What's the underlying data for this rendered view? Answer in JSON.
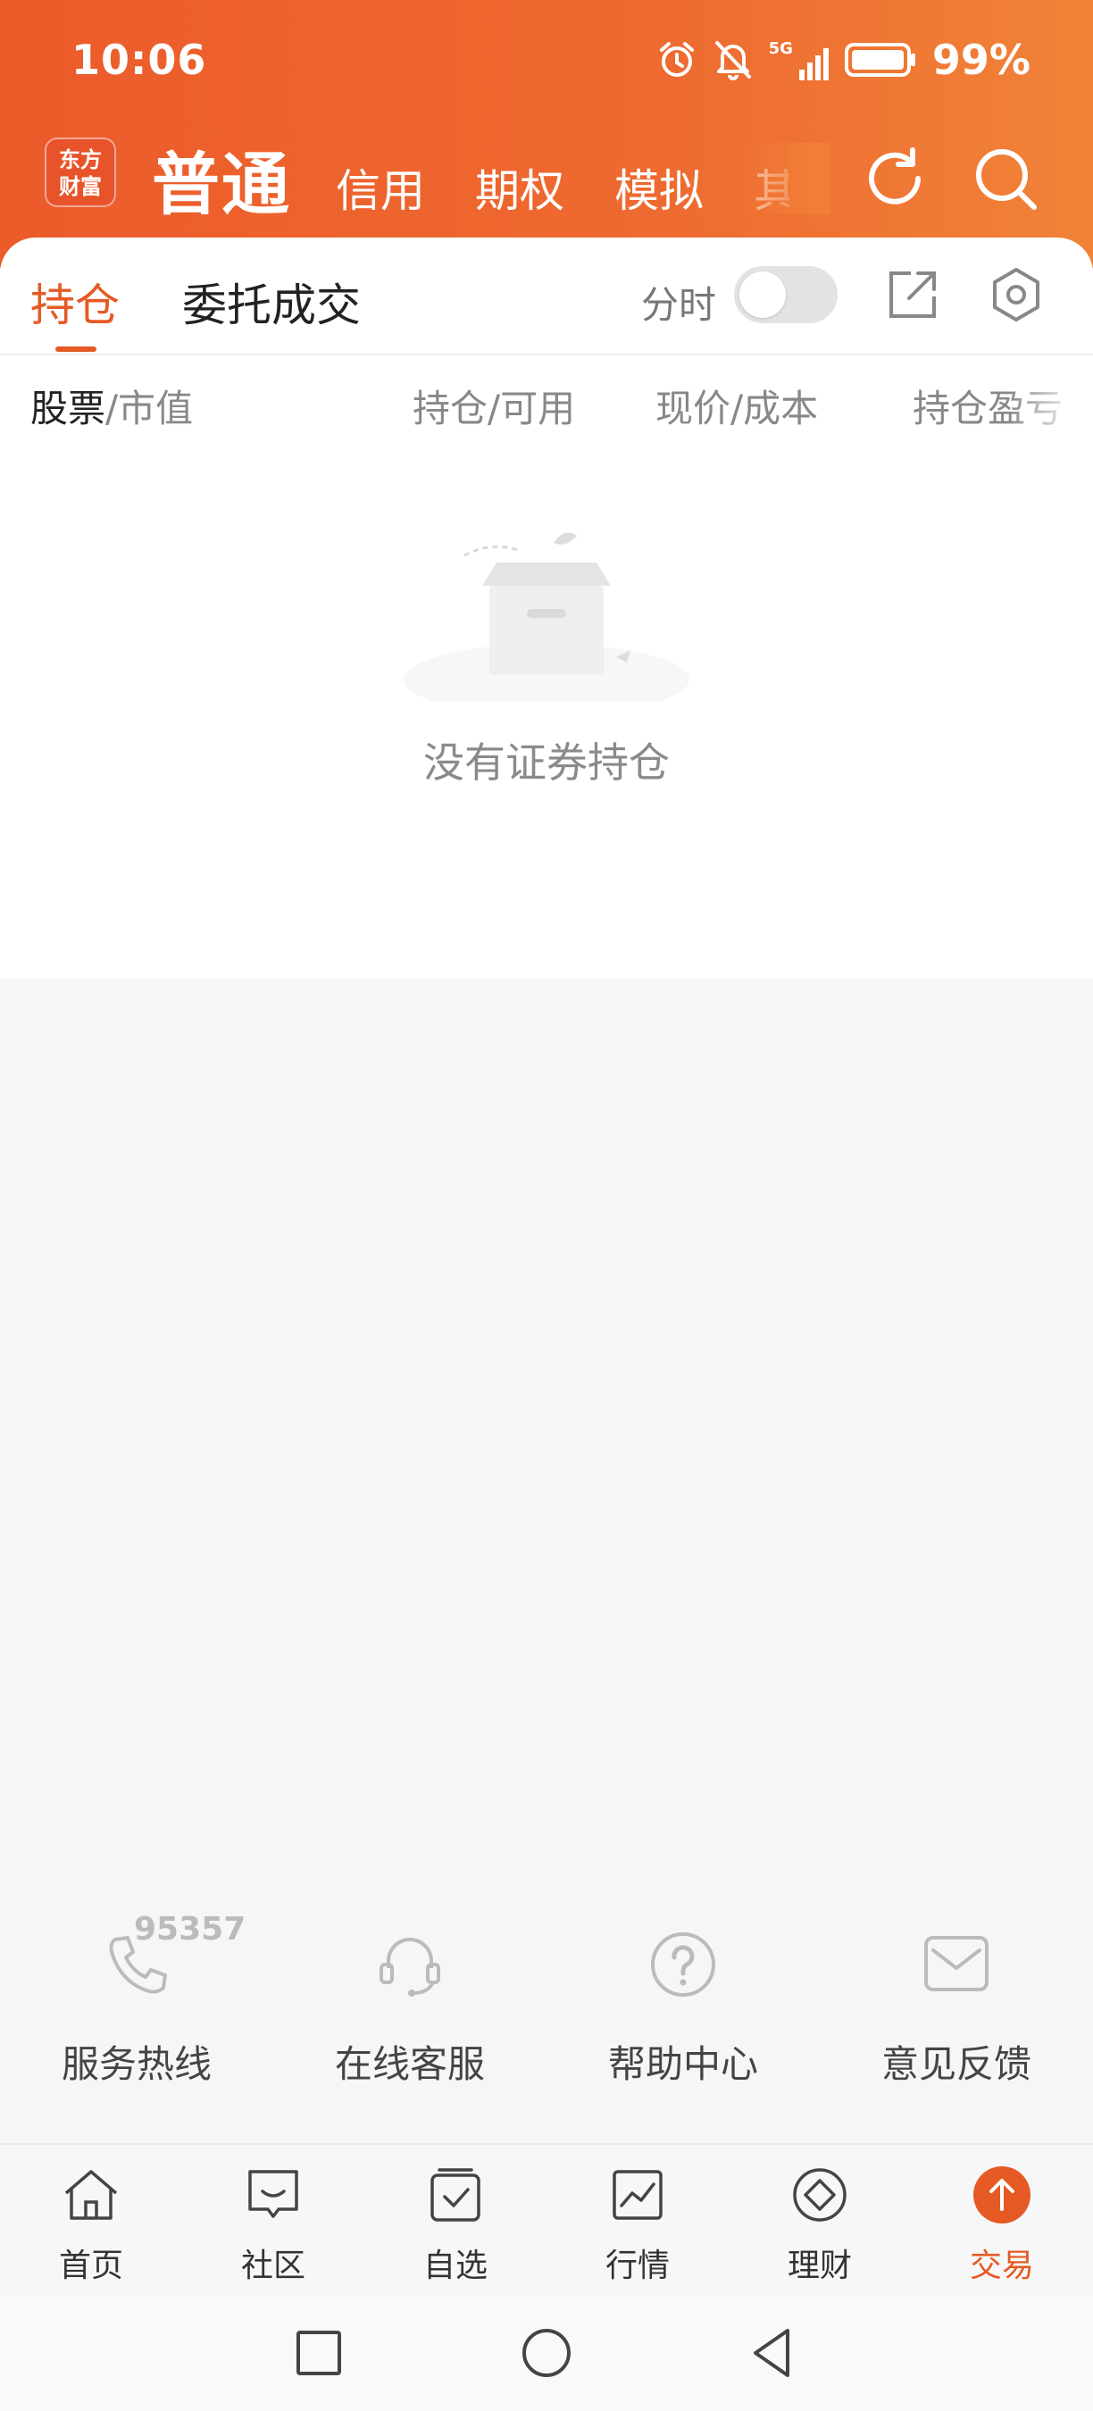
{
  "status_bar": {
    "time": "10:06",
    "network": "5G",
    "battery": "99%"
  },
  "nav": {
    "logo_line1": "东方",
    "logo_line2": "财富",
    "tabs": [
      {
        "label": "普通",
        "active": true
      },
      {
        "label": "信用"
      },
      {
        "label": "期权"
      },
      {
        "label": "模拟"
      },
      {
        "label": "其"
      }
    ]
  },
  "segments": {
    "holdings": "持仓",
    "orders": "委托成交"
  },
  "toggle": {
    "label": "分时",
    "on": false
  },
  "columns": {
    "stock": "股票",
    "market_value": "/市值",
    "position": "持仓/可用",
    "price": "现价/成本",
    "pnl": "持仓盈亏"
  },
  "empty": {
    "message": "没有证券持仓"
  },
  "services": [
    {
      "label": "服务热线",
      "badge": "95357",
      "icon": "phone-icon"
    },
    {
      "label": "在线客服",
      "icon": "headset-icon"
    },
    {
      "label": "帮助中心",
      "icon": "question-icon"
    },
    {
      "label": "意见反馈",
      "icon": "mail-icon"
    }
  ],
  "tabbar": [
    {
      "label": "首页",
      "icon": "home-icon"
    },
    {
      "label": "社区",
      "icon": "chat-icon"
    },
    {
      "label": "自选",
      "icon": "checkbox-icon"
    },
    {
      "label": "行情",
      "icon": "chart-icon"
    },
    {
      "label": "理财",
      "icon": "diamond-icon"
    },
    {
      "label": "交易",
      "icon": "trade-icon",
      "active": true
    }
  ],
  "colors": {
    "brand": "#EC5B2A",
    "accent": "#E55A24",
    "background": "#F5F6F8"
  }
}
